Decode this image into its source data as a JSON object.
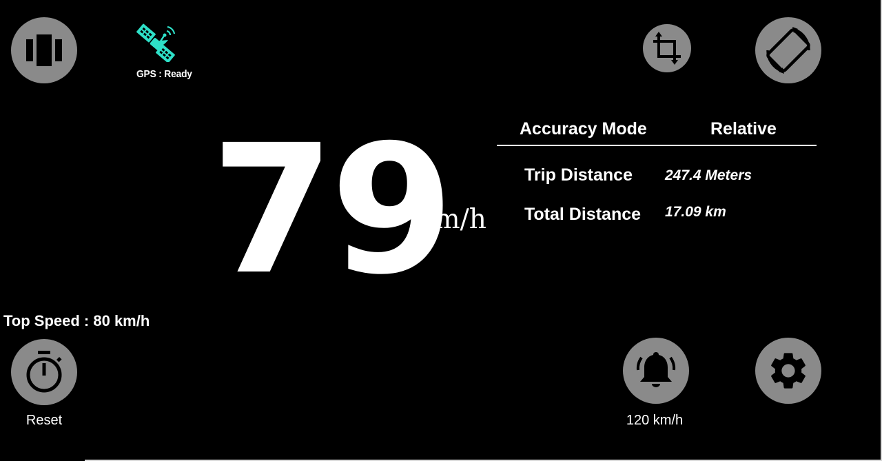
{
  "gps": {
    "icon": "satellite-icon",
    "status_label": "GPS : Ready",
    "icon_color": "#2ee0c8"
  },
  "toolbar": {
    "layout_button_icon": "view-carousel-icon",
    "crop_button_icon": "crop-icon",
    "rotate_button_icon": "screen-rotation-icon"
  },
  "speed": {
    "value": "79",
    "unit": "km/h"
  },
  "accuracy": {
    "label": "Accuracy Mode",
    "value": "Relative"
  },
  "stats": [
    {
      "label": "Trip Distance",
      "value": "247.4 Meters"
    },
    {
      "label": "Total Distance",
      "value": "17.09 km"
    }
  ],
  "top_speed": {
    "text": "Top Speed : 80 km/h"
  },
  "bottom_controls": {
    "reset": {
      "icon": "stopwatch-icon",
      "label": "Reset"
    },
    "alarm": {
      "icon": "bell-ringing-icon",
      "label": "120 km/h"
    },
    "settings": {
      "icon": "gear-icon"
    }
  },
  "colors": {
    "background": "#000000",
    "button_fill": "#8a8a8a",
    "text": "#ffffff",
    "accent": "#2ee0c8"
  }
}
